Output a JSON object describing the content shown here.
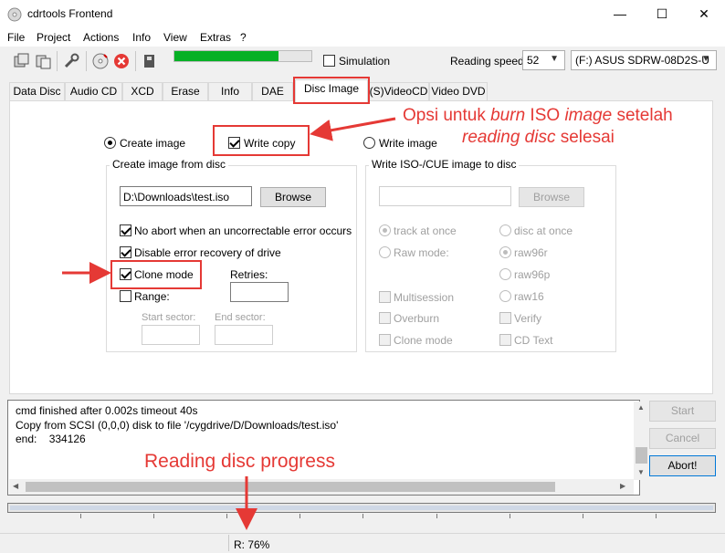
{
  "window": {
    "title": "cdrtools Frontend",
    "min": "—",
    "max": "☐",
    "close": "✕"
  },
  "menu": [
    "File",
    "Project",
    "Actions",
    "Info",
    "View",
    "Extras",
    "?"
  ],
  "toolbar": {
    "progress_fraction": 0.76,
    "simulation_label": "Simulation",
    "reading_speed_label": "Reading speed",
    "reading_speed_value": "52",
    "drive_value": "(F:) ASUS SDRW-08D2S-U"
  },
  "tabs": [
    "Data Disc",
    "Audio CD",
    "XCD",
    "Erase",
    "Info",
    "DAE",
    "Disc Image",
    "(S)VideoCD",
    "Video DVD"
  ],
  "active_tab": "Disc Image",
  "disc_image": {
    "create_image_label": "Create image",
    "write_copy_label": "Write copy",
    "write_image_label": "Write image",
    "create_group_title": "Create image from disc",
    "image_path": "D:\\Downloads\\test.iso",
    "browse_label": "Browse",
    "no_abort_label": "No abort when an uncorrectable error occurs",
    "disable_recovery_label": "Disable error recovery of drive",
    "clone_mode_label": "Clone mode",
    "retries_label": "Retries:",
    "range_label": "Range:",
    "start_sector_label": "Start sector:",
    "end_sector_label": "End sector:",
    "write_group_title": "Write ISO-/CUE image to disc",
    "write_browse_label": "Browse",
    "track_at_once_label": "track at once",
    "disc_at_once_label": "disc at once",
    "raw_mode_label": "Raw mode:",
    "raw96r_label": "raw96r",
    "raw96p_label": "raw96p",
    "raw16_label": "raw16",
    "multisession_label": "Multisession",
    "overburn_label": "Overburn",
    "write_clone_mode_label": "Clone mode",
    "verify_label": "Verify",
    "cd_text_label": "CD Text"
  },
  "log": [
    "cmd finished after 0.002s timeout 40s",
    "Copy from SCSI (0,0,0) disk to file '/cygdrive/D/Downloads/test.iso'",
    "end:    334126"
  ],
  "buttons": {
    "start": "Start",
    "cancel": "Cancel",
    "abort": "Abort!"
  },
  "status": {
    "text": "R: 76%"
  },
  "annotations": {
    "burn_note_line1_a": "Opsi untuk ",
    "burn_note_line1_b": "burn",
    "burn_note_line1_c": " ISO ",
    "burn_note_line1_d": "image",
    "burn_note_line1_e": " setelah",
    "burn_note_line2_a": "reading disc",
    "burn_note_line2_b": " selesai",
    "progress_note": "Reading disc progress"
  },
  "colors": {
    "accent": "#0078d7",
    "progress": "#06b025",
    "annotation": "#e53935"
  }
}
